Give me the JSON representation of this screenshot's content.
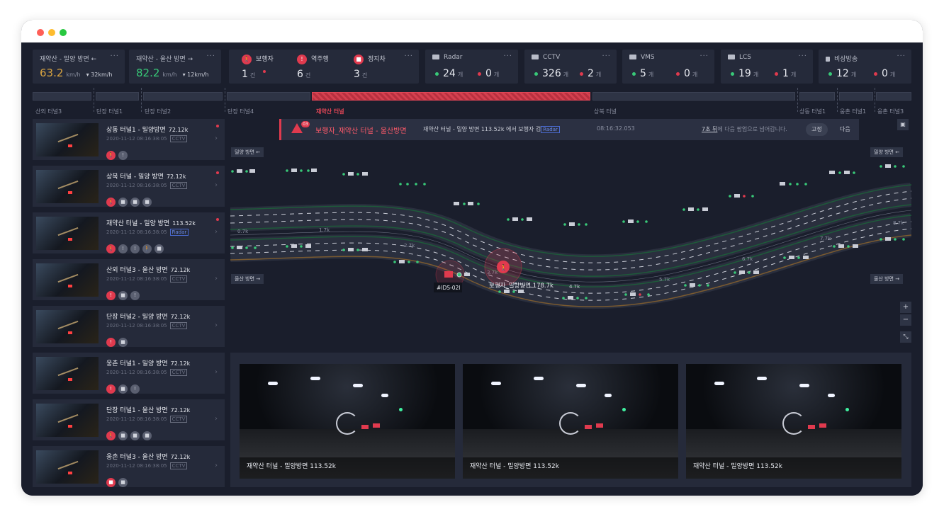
{
  "speed_cards": [
    {
      "label": "재약산 - 밀양 방면",
      "arrow": "←",
      "speed": "63.2",
      "unit": "km/h",
      "sub": "▾ 32km/h",
      "color": "#d9a441"
    },
    {
      "label": "재약산 - 울산 방면",
      "arrow": "→",
      "speed": "82.2",
      "unit": "km/h",
      "sub": "▾ 12km/h",
      "color": "#38c978"
    }
  ],
  "events": [
    {
      "label": "보행자",
      "count": "1",
      "unit": "건"
    },
    {
      "label": "역주행",
      "count": "6",
      "unit": "건"
    },
    {
      "label": "정지차",
      "count": "3",
      "unit": "건"
    }
  ],
  "devices": [
    {
      "label": "Radar",
      "ok": "24",
      "err": "0",
      "unit": "개"
    },
    {
      "label": "CCTV",
      "ok": "326",
      "err": "2",
      "unit": "개"
    },
    {
      "label": "VMS",
      "ok": "5",
      "err": "0",
      "unit": "개"
    },
    {
      "label": "LCS",
      "ok": "19",
      "err": "1",
      "unit": "개"
    },
    {
      "label": "비상방송",
      "ok": "12",
      "err": "0",
      "unit": "개"
    }
  ],
  "more": "···",
  "tunnels": [
    "산외 터널3",
    "단장 터널1",
    "단장 터널2",
    "단장 터널4",
    "재약산 터널",
    "상북 터널",
    "상동 터널1",
    "웅촌 터널1",
    "웅촌 터널3"
  ],
  "list": [
    {
      "title": "상동 터널1 - 밀양방면",
      "km": "72.12k",
      "date": "2020-11-12 08:16:38:05",
      "tag": "CCTV",
      "dot": true
    },
    {
      "title": "상북 터널 - 밀양 방면",
      "km": "72.12k",
      "date": "2020-11-12 08:16:38:05",
      "tag": "CCTV",
      "dot": true
    },
    {
      "title": "재약산 터널 - 밀양 방면",
      "km": "113.52k",
      "date": "2020-11-12 08:16:38:05",
      "tag": "Radar",
      "dot": true
    },
    {
      "title": "산외 터널3 - 울산 방면",
      "km": "72.12k",
      "date": "2020-11-12 08:16:38:05",
      "tag": "CCTV",
      "dot": false
    },
    {
      "title": "단장 터널2 - 밀양 방면",
      "km": "72.12k",
      "date": "2020-11-12 08:16:38:05",
      "tag": "CCTV",
      "dot": false
    },
    {
      "title": "웅촌 터널1 - 밀양 방면",
      "km": "72.12k",
      "date": "2020-11-12 08:16:38:05",
      "tag": "CCTV",
      "dot": false
    },
    {
      "title": "단장 터널1 - 울산 방면",
      "km": "72.12k",
      "date": "2020-11-12 08:16:38:05",
      "tag": "CCTV",
      "dot": false
    },
    {
      "title": "웅촌 터널3 - 울산 방면",
      "km": "72.12k",
      "date": "2020-11-12 08:16:38:05",
      "tag": "CCTV",
      "dot": false
    }
  ],
  "alert": {
    "badge": "03",
    "title": "보행자_재약산 터널 - 울산방면",
    "desc": "재약산 터널 - 밀양 방면 113.52k 에서 보행자 검",
    "tag": "Radar",
    "time": "08:16:32.053",
    "note_link": "7초 뒤",
    "note_rest": "에 다음 팝업으로 넘어갑니다.",
    "fix": "고정",
    "next": "다음"
  },
  "map": {
    "dir_top_left": "밀양 방면 ←",
    "dir_top_right": "밀양 방면 ←",
    "dir_bot_left": "울산 방면 →",
    "dir_bot_right": "울산 방면 →",
    "km_labels": [
      "0.7k",
      "1.7k",
      "2.7k",
      "3.7k",
      "4.7k",
      "5.7k",
      "6.7k",
      "7.7k",
      "8.7k"
    ],
    "device_id": "#IDS-02l",
    "event_label": "보행자_밀양방면 178.7k",
    "zoom_in": "+",
    "zoom_out": "−",
    "fit": "⤡"
  },
  "cameras": [
    {
      "caption": "재약산 터널 - 밀양방면 113.52k"
    },
    {
      "caption": "재약산 터널 - 밀양방면 113.52k"
    },
    {
      "caption": "재약산 터널 - 밀양방면 113.52k"
    }
  ],
  "colors": {
    "accent_red": "#e03a4e",
    "ok_green": "#38c978",
    "speed_amber": "#d9a441",
    "bg": "#1a1e2c",
    "panel": "#252a3a"
  }
}
